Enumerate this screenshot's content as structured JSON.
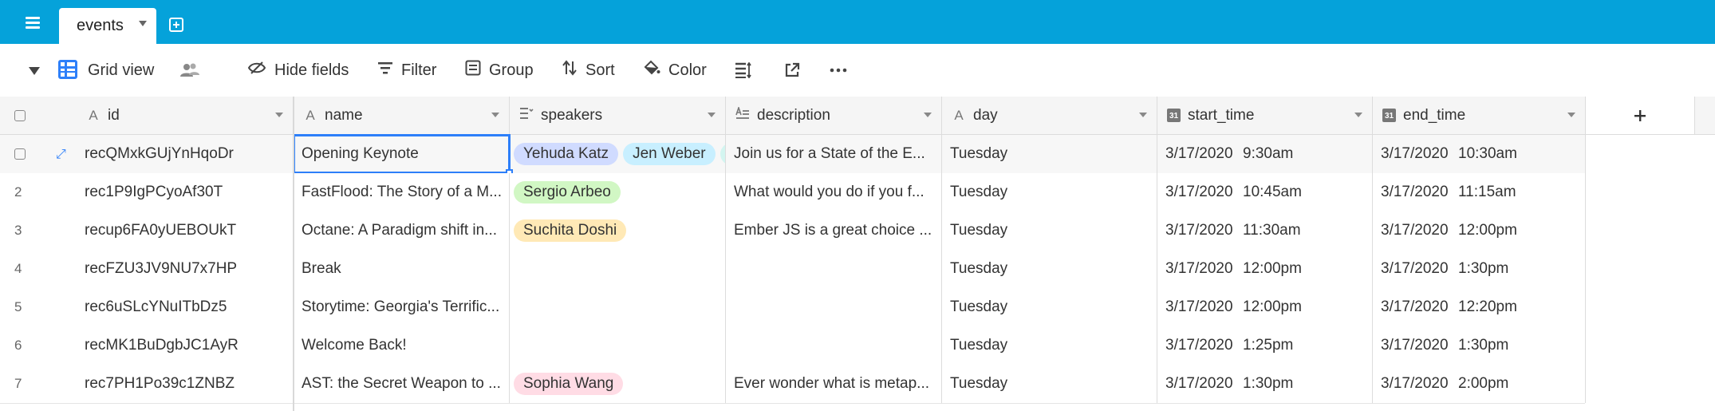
{
  "tab": {
    "label": "events"
  },
  "toolbar": {
    "view_name": "Grid view",
    "hide_fields": "Hide fields",
    "filter": "Filter",
    "group": "Group",
    "sort": "Sort",
    "color": "Color"
  },
  "columns": [
    {
      "label": "id",
      "type": "text"
    },
    {
      "label": "name",
      "type": "text"
    },
    {
      "label": "speakers",
      "type": "multiselect"
    },
    {
      "label": "description",
      "type": "longtext"
    },
    {
      "label": "day",
      "type": "text"
    },
    {
      "label": "start_time",
      "type": "date"
    },
    {
      "label": "end_time",
      "type": "date"
    }
  ],
  "rows": [
    {
      "num": "",
      "id": "recQMxkGUjYnHqoDr",
      "name": "Opening Keynote",
      "speakers": [
        {
          "name": "Yehuda Katz",
          "color": "#d0dbff"
        },
        {
          "name": "Jen Weber",
          "color": "#c8efff"
        },
        {
          "name": "",
          "color": "#d3f5f0"
        }
      ],
      "description": "Join us for a State of the E...",
      "day": "Tuesday",
      "start_date": "3/17/2020",
      "start_time": "9:30am",
      "end_date": "3/17/2020",
      "end_time": "10:30am"
    },
    {
      "num": "2",
      "id": "rec1P9IgPCyoAf30T",
      "name": "FastFlood: The Story of a M...",
      "speakers": [
        {
          "name": "Sergio Arbeo",
          "color": "#d1f7c4"
        }
      ],
      "description": "What would you do if you f...",
      "day": "Tuesday",
      "start_date": "3/17/2020",
      "start_time": "10:45am",
      "end_date": "3/17/2020",
      "end_time": "11:15am"
    },
    {
      "num": "3",
      "id": "recup6FA0yUEBOUkT",
      "name": "Octane: A Paradigm shift in...",
      "speakers": [
        {
          "name": "Suchita Doshi",
          "color": "#ffe9b6"
        }
      ],
      "description": "Ember JS is a great choice ...",
      "day": "Tuesday",
      "start_date": "3/17/2020",
      "start_time": "11:30am",
      "end_date": "3/17/2020",
      "end_time": "12:00pm"
    },
    {
      "num": "4",
      "id": "recFZU3JV9NU7x7HP",
      "name": "Break",
      "speakers": [],
      "description": "",
      "day": "Tuesday",
      "start_date": "3/17/2020",
      "start_time": "12:00pm",
      "end_date": "3/17/2020",
      "end_time": "1:30pm"
    },
    {
      "num": "5",
      "id": "rec6uSLcYNuITbDz5",
      "name": "Storytime: Georgia's Terrific...",
      "speakers": [],
      "description": "",
      "day": "Tuesday",
      "start_date": "3/17/2020",
      "start_time": "12:00pm",
      "end_date": "3/17/2020",
      "end_time": "12:20pm"
    },
    {
      "num": "6",
      "id": "recMK1BuDgbJC1AyR",
      "name": "Welcome Back!",
      "speakers": [],
      "description": "",
      "day": "Tuesday",
      "start_date": "3/17/2020",
      "start_time": "1:25pm",
      "end_date": "3/17/2020",
      "end_time": "1:30pm"
    },
    {
      "num": "7",
      "id": "rec7PH1Po39c1ZNBZ",
      "name": "AST: the Secret Weapon to ...",
      "speakers": [
        {
          "name": "Sophia Wang",
          "color": "#ffdce5"
        }
      ],
      "description": "Ever wonder what is metap...",
      "day": "Tuesday",
      "start_date": "3/17/2020",
      "start_time": "1:30pm",
      "end_date": "3/17/2020",
      "end_time": "2:00pm"
    }
  ]
}
